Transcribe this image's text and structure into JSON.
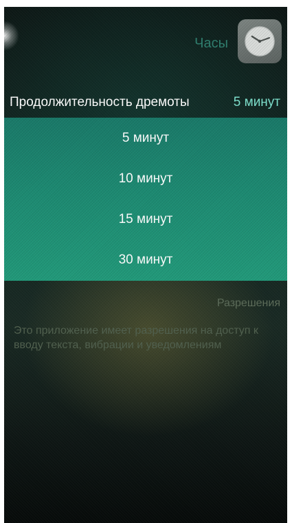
{
  "header": {
    "app_title": "Часы",
    "app_icon": "clock-icon"
  },
  "setting": {
    "label": "Продолжительность дремоты",
    "value": "5 минут"
  },
  "dropdown": {
    "options": [
      "5 минут",
      "10 минут",
      "15 минут",
      "30 минут"
    ]
  },
  "permissions": {
    "title": "Разрешения",
    "description": "Это приложение имеет разрешения на доступ к вводу текста, вибрации и уведомлениям"
  },
  "colors": {
    "accent": "#7fe3cf",
    "dropdown_bg": "#1d8a72",
    "muted_text": "#51614f"
  }
}
